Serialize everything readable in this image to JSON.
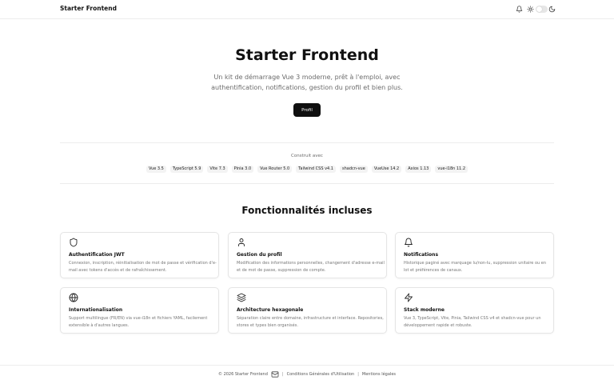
{
  "header": {
    "brand": "Starter Frontend",
    "icons": [
      "bell-icon",
      "sun-icon",
      "theme-toggle",
      "moon-icon"
    ]
  },
  "hero": {
    "title": "Starter Frontend",
    "subtitle": "Un kit de démarrage Vue 3 moderne, prêt à l'emploi, avec authentification, notifications, gestion du profil et bien plus.",
    "button": "Profil"
  },
  "built_with": {
    "label": "Construit avec",
    "tags": [
      "Vue 3.5",
      "TypeScript 5.9",
      "Vite 7.3",
      "Pinia 3.0",
      "Vue Router 5.0",
      "Tailwind CSS v4.1",
      "shadcn-vue",
      "VueUse 14.2",
      "Axios 1.13",
      "vue-i18n 11.2"
    ]
  },
  "features": {
    "title": "Fonctionnalités incluses",
    "items": [
      {
        "icon": "shield-icon",
        "title": "Authentification JWT",
        "desc": "Connexion, inscription, réinitialisation de mot de passe et vérification d'e-mail avec tokens d'accès et de rafraîchissement."
      },
      {
        "icon": "user-icon",
        "title": "Gestion du profil",
        "desc": "Modification des informations personnelles, changement d'adresse e-mail et de mot de passe, suppression de compte."
      },
      {
        "icon": "bell-icon",
        "title": "Notifications",
        "desc": "Historique paginé avec marquage lu/non-lu, suppression unitaire ou en lot et préférences de canaux."
      },
      {
        "icon": "globe-icon",
        "title": "Internationalisation",
        "desc": "Support multilingue (FR/EN) via vue-i18n et fichiers YAML, facilement extensible à d'autres langues."
      },
      {
        "icon": "layers-icon",
        "title": "Architecture hexagonale",
        "desc": "Séparation claire entre domaine, infrastructure et interface. Repositories, stores et types bien organisés."
      },
      {
        "icon": "zap-icon",
        "title": "Stack moderne",
        "desc": "Vue 3, TypeScript, Vite, Pinia, Tailwind CSS v4 et shadcn-vue pour un développement rapide et robuste."
      }
    ]
  },
  "footer": {
    "copyright": "© 2026 Starter Frontend",
    "sep1": "|",
    "terms": "Conditions Générales d'Utilisation",
    "sep2": "|",
    "legal": "Mentions légales"
  }
}
